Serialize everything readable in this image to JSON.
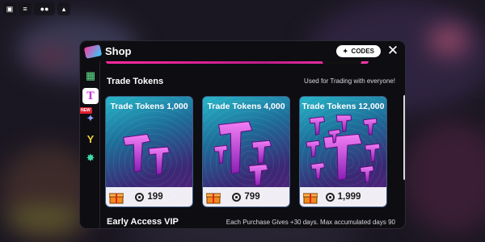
{
  "top_buttons": [
    {
      "icon": "roblox-menu-icon",
      "glyph": "▣"
    },
    {
      "icon": "chat-icon",
      "glyph": "≡"
    },
    {
      "icon": "players-icon",
      "glyph": "●●"
    },
    {
      "icon": "backpack-icon",
      "glyph": "▴"
    }
  ],
  "panel": {
    "title": "Shop",
    "codes_label": "CODES",
    "close_glyph": "✕"
  },
  "sidebar": {
    "new_badge": "NEW",
    "items": [
      {
        "icon": "cash-bundle-icon",
        "glyph": "▦"
      },
      {
        "icon": "trade-token-icon",
        "glyph": "T"
      },
      {
        "icon": "sparkle-icon",
        "glyph": "✦"
      },
      {
        "icon": "trophy-icon",
        "glyph": "Y"
      },
      {
        "icon": "gem-icon",
        "glyph": "✸"
      }
    ]
  },
  "section": {
    "title": "Trade Tokens",
    "note": "Used for Trading with everyone!"
  },
  "products": [
    {
      "name": "Trade Tokens 1,000",
      "price": "199"
    },
    {
      "name": "Trade Tokens 4,000",
      "price": "799"
    },
    {
      "name": "Trade Tokens 12,000",
      "price": "1,999"
    }
  ],
  "next_section": {
    "title": "Early Access VIP",
    "note": "Each Purchase Gives +30 days. Max accumulated days 90"
  },
  "colors": {
    "accent_pink": "#ff2aa0",
    "card_top": "#27b6c8",
    "card_bottom": "#5a1f7a",
    "token_magenta": "#c53bd8"
  }
}
